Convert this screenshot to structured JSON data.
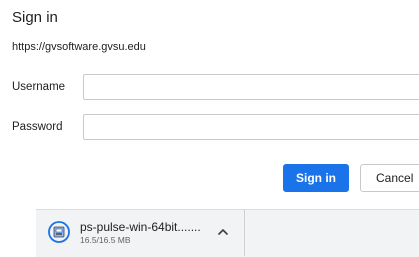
{
  "dialog": {
    "title": "Sign in",
    "origin": "https://gvsoftware.gvsu.edu",
    "username_label": "Username",
    "username_value": "",
    "password_label": "Password",
    "password_value": "",
    "sign_in_button": "Sign in",
    "cancel_button": "Cancel",
    "accent_color": "#1a73e8"
  },
  "download_bar": {
    "item": {
      "file_name": "ps-pulse-win-64bit.......",
      "file_size": "16.5/16.5 MB",
      "icon": "installer-package-icon"
    },
    "menu_icon": "chevron-up-icon"
  }
}
